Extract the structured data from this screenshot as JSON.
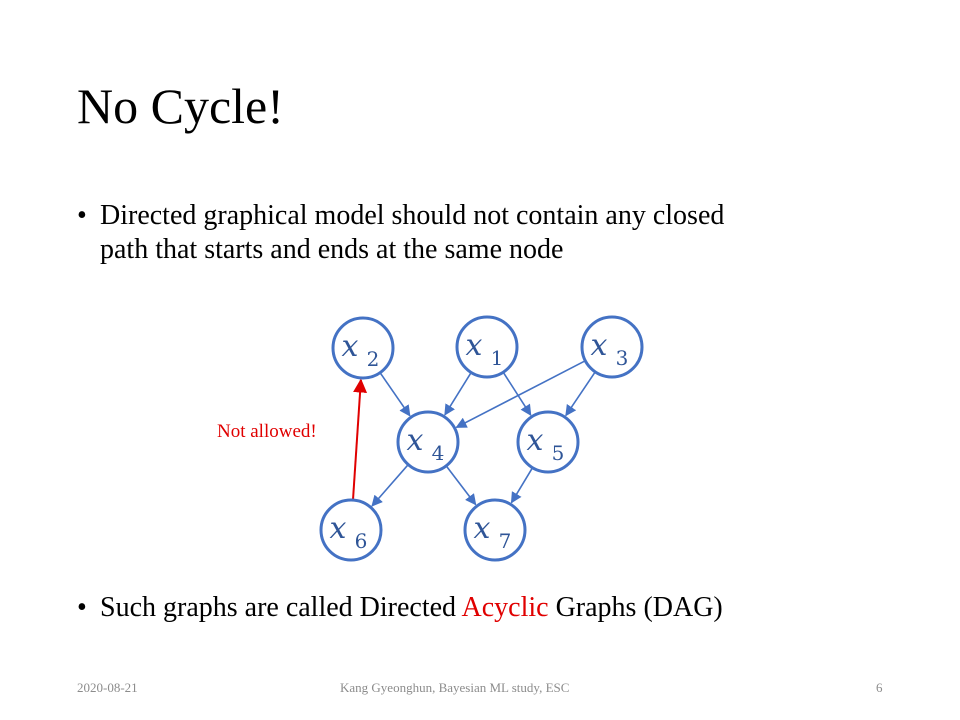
{
  "slide": {
    "title": "No Cycle!",
    "bullets": [
      {
        "marker": "•",
        "line1": "Directed graphical model should not contain any closed",
        "line2": "path that starts and ends at the same node"
      },
      {
        "marker": "•",
        "prefix": "Such graphs are called Directed ",
        "highlight": "Acyclic",
        "suffix": " Graphs (DAG)"
      }
    ],
    "footer": {
      "date": "2020-08-21",
      "center": "Kang Gyeonghun,  Bayesian  ML study, ESC",
      "page": "6"
    }
  },
  "diagram": {
    "annotation": "Not allowed!",
    "nodes": [
      {
        "id": "x2",
        "symbol": "x",
        "subscript": "2"
      },
      {
        "id": "x1",
        "symbol": "x",
        "subscript": "1"
      },
      {
        "id": "x3",
        "symbol": "x",
        "subscript": "3"
      },
      {
        "id": "x4",
        "symbol": "x",
        "subscript": "4"
      },
      {
        "id": "x5",
        "symbol": "x",
        "subscript": "5"
      },
      {
        "id": "x6",
        "symbol": "x",
        "subscript": "6"
      },
      {
        "id": "x7",
        "symbol": "x",
        "subscript": "7"
      }
    ],
    "edges": [
      {
        "from": "x2",
        "to": "x4",
        "allowed": true
      },
      {
        "from": "x1",
        "to": "x4",
        "allowed": true
      },
      {
        "from": "x1",
        "to": "x5",
        "allowed": true
      },
      {
        "from": "x3",
        "to": "x4",
        "allowed": true
      },
      {
        "from": "x3",
        "to": "x5",
        "allowed": true
      },
      {
        "from": "x4",
        "to": "x6",
        "allowed": true
      },
      {
        "from": "x4",
        "to": "x7",
        "allowed": true
      },
      {
        "from": "x5",
        "to": "x7",
        "allowed": true
      },
      {
        "from": "x6",
        "to": "x2",
        "allowed": false
      }
    ],
    "colors": {
      "node_stroke": "#4472c4",
      "node_text": "#2f5597",
      "edge": "#4472c4",
      "forbidden_edge": "#e00000"
    }
  }
}
